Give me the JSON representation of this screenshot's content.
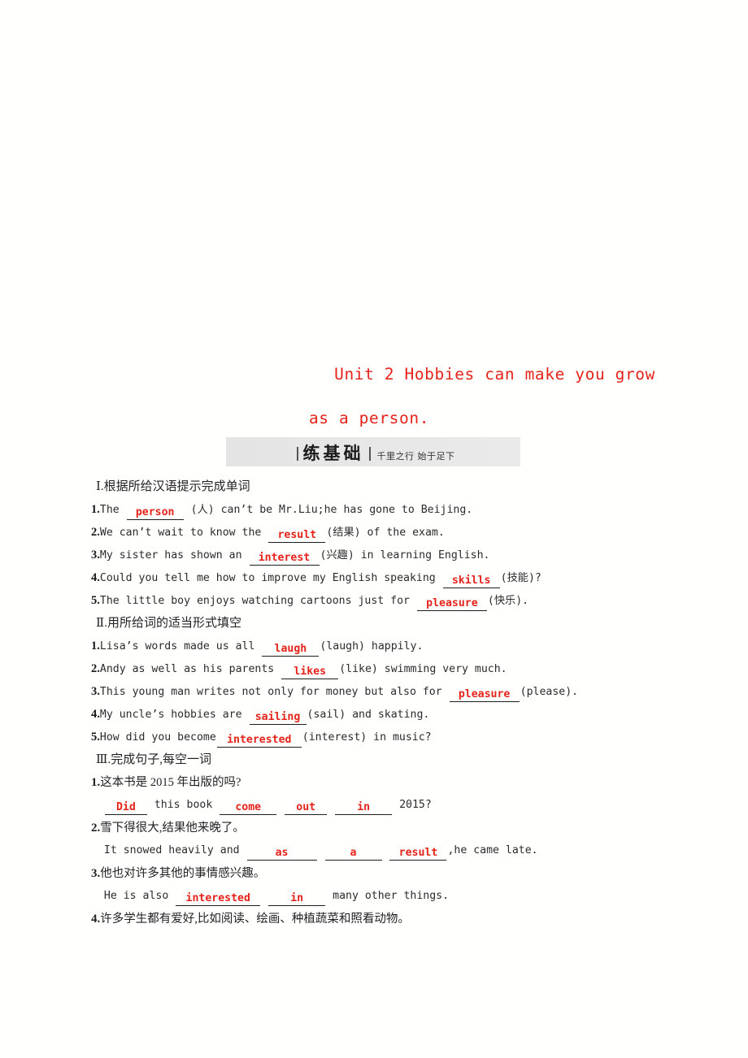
{
  "title": {
    "line1": "Unit 2  Hobbies can make you grow",
    "line2": "as a person."
  },
  "banner": {
    "main": "练基础",
    "sub": "千里之行 始于足下",
    "accent_color": "#e5231b",
    "background": "#e7e7e7"
  },
  "sections": [
    {
      "heading": "Ⅰ.根据所给汉语提示完成单词",
      "items": [
        {
          "index": "1.",
          "parts": [
            {
              "t": "text",
              "v": "The "
            },
            {
              "t": "blank",
              "v": "person",
              "w": "w-md"
            },
            {
              "t": "text",
              "v": " (人) can’t be Mr.Liu;he has gone to Beijing."
            }
          ]
        },
        {
          "index": "2.",
          "parts": [
            {
              "t": "text",
              "v": "We can’t wait to know the "
            },
            {
              "t": "blank",
              "v": "result",
              "w": "w-md"
            },
            {
              "t": "text",
              "v": "(结果) of the exam."
            }
          ]
        },
        {
          "index": "3.",
          "parts": [
            {
              "t": "text",
              "v": "My sister has shown an "
            },
            {
              "t": "blank",
              "v": "interest",
              "w": "w-lg"
            },
            {
              "t": "text",
              "v": "(兴趣) in learning English."
            }
          ]
        },
        {
          "index": "4.",
          "parts": [
            {
              "t": "text",
              "v": "Could you tell me how to improve my English speaking "
            },
            {
              "t": "blank",
              "v": "skills",
              "w": "w-md"
            },
            {
              "t": "text",
              "v": "(技能)?"
            }
          ]
        },
        {
          "index": "5.",
          "parts": [
            {
              "t": "text",
              "v": "The little boy enjoys watching cartoons just for "
            },
            {
              "t": "blank",
              "v": "pleasure",
              "w": "w-lg"
            },
            {
              "t": "text",
              "v": "(快乐)."
            }
          ]
        }
      ]
    },
    {
      "heading": "Ⅱ.用所给词的适当形式填空",
      "items": [
        {
          "index": "1.",
          "parts": [
            {
              "t": "text",
              "v": "Lisa’s words made us all "
            },
            {
              "t": "blank",
              "v": "laugh",
              "w": "w-md"
            },
            {
              "t": "text",
              "v": "(laugh) happily."
            }
          ]
        },
        {
          "index": "2.",
          "parts": [
            {
              "t": "text",
              "v": "Andy as well as his parents "
            },
            {
              "t": "blank",
              "v": "likes",
              "w": "w-md"
            },
            {
              "t": "text",
              "v": "(like) swimming very much."
            }
          ]
        },
        {
          "index": "3.",
          "parts": [
            {
              "t": "text",
              "v": "This young man writes not only for money but also for "
            },
            {
              "t": "blank",
              "v": "pleasure",
              "w": "w-lg"
            },
            {
              "t": "text",
              "v": "(please)."
            }
          ]
        },
        {
          "index": "4.",
          "parts": [
            {
              "t": "text",
              "v": "My uncle’s hobbies are "
            },
            {
              "t": "blank",
              "v": "sailing",
              "w": "w-md"
            },
            {
              "t": "text",
              "v": "(sail) and skating."
            }
          ]
        },
        {
          "index": "5.",
          "parts": [
            {
              "t": "text",
              "v": "How did you become"
            },
            {
              "t": "blank",
              "v": "interested",
              "w": "w-xl"
            },
            {
              "t": "text",
              "v": "(interest) in music?"
            }
          ]
        }
      ]
    },
    {
      "heading": "Ⅲ.完成句子,每空一词",
      "items": [
        {
          "index": "1.",
          "cn": "这本书是 2015 年出版的吗?"
        },
        {
          "index": "",
          "indent": true,
          "parts": [
            {
              "t": "blank",
              "v": "Did",
              "w": "w-sm"
            },
            {
              "t": "text",
              "v": " this book "
            },
            {
              "t": "blank",
              "v": "come",
              "w": "w-md"
            },
            {
              "t": "text",
              "v": " "
            },
            {
              "t": "blank",
              "v": "out",
              "w": "w-sm"
            },
            {
              "t": "text",
              "v": " "
            },
            {
              "t": "blank",
              "v": "in",
              "w": "w-md"
            },
            {
              "t": "text",
              "v": " 2015?"
            }
          ]
        },
        {
          "index": "2.",
          "cn": "雪下得很大,结果他来晚了。"
        },
        {
          "index": "",
          "parts": [
            {
              "t": "text",
              "v": "It snowed heavily and "
            },
            {
              "t": "blank",
              "v": "as",
              "w": "w-lg"
            },
            {
              "t": "text",
              "v": " "
            },
            {
              "t": "blank",
              "v": "a",
              "w": "w-md"
            },
            {
              "t": "text",
              "v": " "
            },
            {
              "t": "blank",
              "v": "result",
              "w": "w-md"
            },
            {
              "t": "text",
              "v": ",he came late."
            }
          ]
        },
        {
          "index": "3.",
          "cn": "他也对许多其他的事情感兴趣。"
        },
        {
          "index": "",
          "parts": [
            {
              "t": "text",
              "v": "He is also "
            },
            {
              "t": "blank",
              "v": "interested",
              "w": "w-xl"
            },
            {
              "t": "text",
              "v": " "
            },
            {
              "t": "blank",
              "v": "in",
              "w": "w-md"
            },
            {
              "t": "text",
              "v": " many other things."
            }
          ]
        },
        {
          "index": "4.",
          "cn": "许多学生都有爱好,比如阅读、绘画、种植蔬菜和照看动物。"
        }
      ]
    }
  ]
}
